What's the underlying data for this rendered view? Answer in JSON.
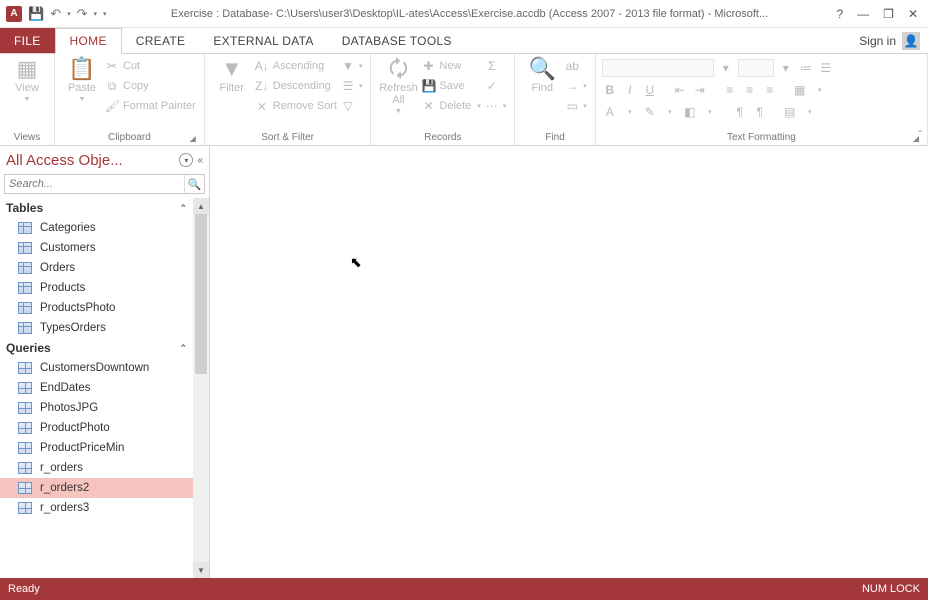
{
  "titlebar": {
    "app_icon_text": "A",
    "title": "Exercise : Database- C:\\Users\\user3\\Desktop\\IL-ates\\Access\\Exercise.accdb (Access 2007 - 2013 file format) - Microsoft...",
    "help_label": "?"
  },
  "tabs": {
    "file": "FILE",
    "home": "HOME",
    "create": "CREATE",
    "external": "EXTERNAL DATA",
    "dbtools": "DATABASE TOOLS",
    "signin": "Sign in"
  },
  "ribbon": {
    "views": {
      "label": "Views",
      "view": "View"
    },
    "clipboard": {
      "label": "Clipboard",
      "paste": "Paste",
      "cut": "Cut",
      "copy": "Copy",
      "format_painter": "Format Painter"
    },
    "sortfilter": {
      "label": "Sort & Filter",
      "filter": "Filter",
      "asc": "Ascending",
      "desc": "Descending",
      "remove": "Remove Sort"
    },
    "records": {
      "label": "Records",
      "refresh": "Refresh All",
      "new": "New",
      "save": "Save",
      "delete": "Delete"
    },
    "find": {
      "label": "Find",
      "find": "Find"
    },
    "textfmt": {
      "label": "Text Formatting"
    }
  },
  "nav": {
    "title": "All Access Obje...",
    "search_placeholder": "Search...",
    "cat_tables": "Tables",
    "cat_queries": "Queries",
    "tables": [
      {
        "name": "Categories"
      },
      {
        "name": "Customers"
      },
      {
        "name": "Orders"
      },
      {
        "name": "Products"
      },
      {
        "name": "ProductsPhoto"
      },
      {
        "name": "TypesOrders"
      }
    ],
    "queries": [
      {
        "name": "CustomersDowntown"
      },
      {
        "name": "EndDates"
      },
      {
        "name": "PhotosJPG"
      },
      {
        "name": "ProductPhoto"
      },
      {
        "name": "ProductPriceMin"
      },
      {
        "name": "r_orders"
      },
      {
        "name": "r_orders2",
        "selected": true
      },
      {
        "name": "r_orders3"
      }
    ]
  },
  "status": {
    "left": "Ready",
    "right": "NUM LOCK"
  }
}
